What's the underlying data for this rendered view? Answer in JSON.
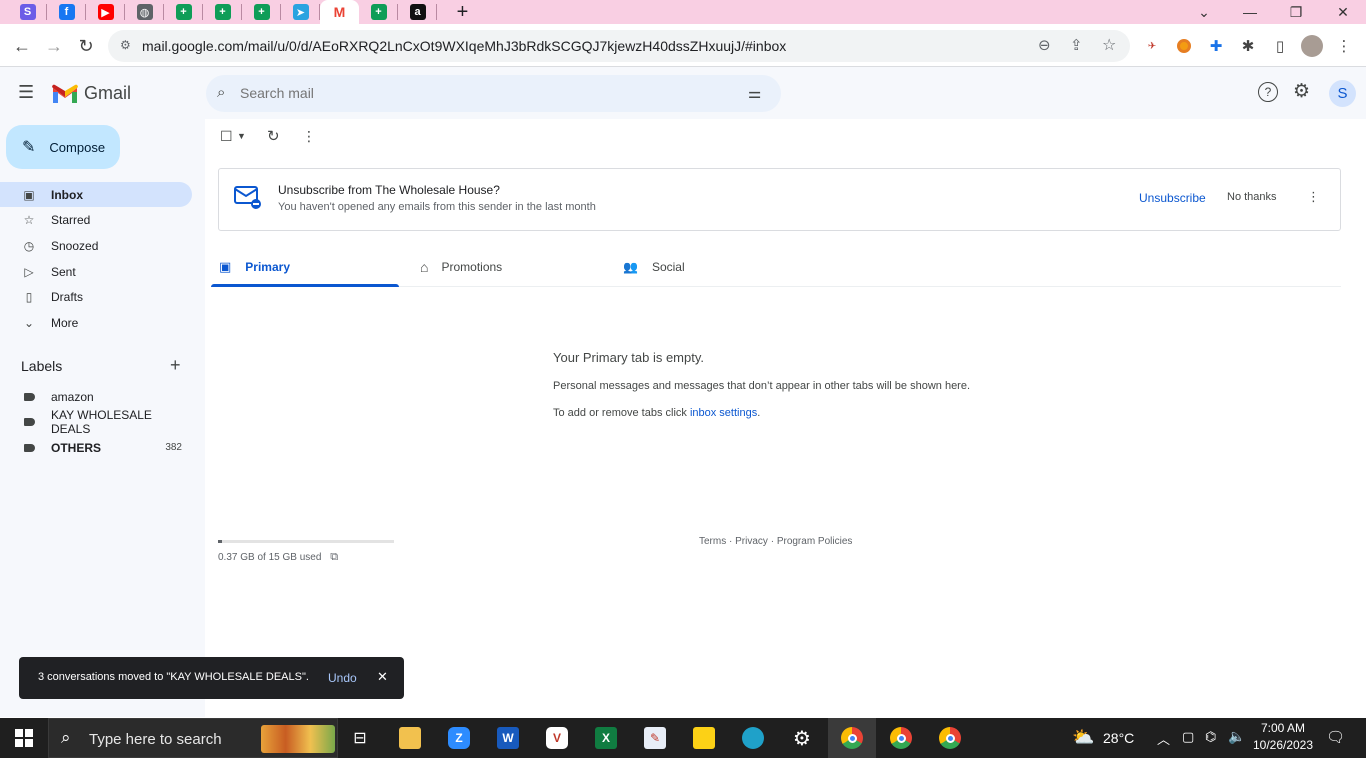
{
  "browser": {
    "tabs": [
      {
        "icon": "s-icon",
        "glyph": "S",
        "color": "#6c5ce7"
      },
      {
        "icon": "facebook-icon",
        "glyph": "f",
        "color": "#1877f2"
      },
      {
        "icon": "youtube-icon",
        "glyph": "▶",
        "color": "#ff0000"
      },
      {
        "icon": "globe-icon",
        "glyph": "◍",
        "color": "#5f6368"
      },
      {
        "icon": "sheets-icon",
        "glyph": "+",
        "color": "#0f9d58"
      },
      {
        "icon": "sheets-icon",
        "glyph": "+",
        "color": "#0f9d58"
      },
      {
        "icon": "sheets-icon",
        "glyph": "+",
        "color": "#0f9d58"
      },
      {
        "icon": "telegram-icon",
        "glyph": "➤",
        "color": "#2aa3e0"
      },
      {
        "icon": "gmail-icon",
        "glyph": "M",
        "color": "#ea4335"
      },
      {
        "icon": "sheets-icon",
        "glyph": "+",
        "color": "#0f9d58"
      },
      {
        "icon": "amazon-icon",
        "glyph": "a",
        "color": "#111111"
      }
    ],
    "new_tab": "+",
    "url": "mail.google.com/mail/u/0/d/AEoRXRQ2LnCxOt9WXIqeMhJ3bRdkSCGQJ7kjewzH40dssZHxuujJ/#inbox"
  },
  "gmail": {
    "logo_text": "Gmail",
    "search_placeholder": "Search mail",
    "avatar_initial": "S",
    "compose_label": "Compose",
    "nav": [
      {
        "label": "Inbox",
        "icon": "inbox-icon"
      },
      {
        "label": "Starred",
        "icon": "star-icon"
      },
      {
        "label": "Snoozed",
        "icon": "clock-icon"
      },
      {
        "label": "Sent",
        "icon": "send-icon"
      },
      {
        "label": "Drafts",
        "icon": "draft-icon"
      },
      {
        "label": "More",
        "icon": "chevron-down-icon"
      }
    ],
    "labels_heading": "Labels",
    "labels": [
      {
        "label": "amazon",
        "count": ""
      },
      {
        "label": "KAY WHOLESALE DEALS",
        "count": ""
      },
      {
        "label": "OTHERS",
        "count": "382"
      }
    ],
    "banner": {
      "title": "Unsubscribe from The Wholesale House?",
      "subtitle": "You haven't opened any emails from this sender in the last month",
      "unsubscribe": "Unsubscribe",
      "no_thanks": "No thanks"
    },
    "tabs": [
      "Primary",
      "Promotions",
      "Social"
    ],
    "empty": {
      "title": "Your Primary tab is empty.",
      "line1": "Personal messages and messages that don’t appear in other tabs will be shown here.",
      "line2_prefix": "To add or remove tabs click ",
      "line2_link": "inbox settings",
      "line2_suffix": "."
    },
    "storage": {
      "text": "0.37 GB of 15 GB used",
      "fraction": 0.025
    },
    "footer": {
      "terms": "Terms",
      "privacy": "Privacy",
      "policies": "Program Policies",
      "sep": " · "
    },
    "snackbar": {
      "message": "3 conversations moved to \"KAY WHOLESALE DEALS\".",
      "undo": "Undo"
    }
  },
  "taskbar": {
    "search_placeholder": "Type here to search",
    "weather": "28°C",
    "time": "7:00 AM",
    "date": "10/26/2023"
  }
}
